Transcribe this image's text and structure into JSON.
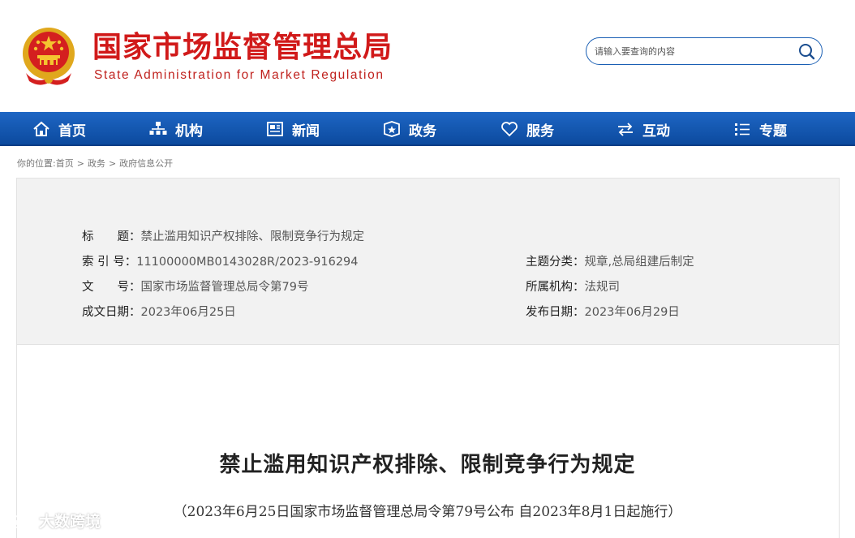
{
  "header": {
    "name_cn": "国家市场监督管理总局",
    "name_en": "State Administration for Market Regulation",
    "emblem_icon": "national-emblem-icon",
    "brand_color": "#d11a1a"
  },
  "search": {
    "placeholder": "请输入要查询的内容",
    "icon": "search-icon",
    "border_color": "#1a5fb4"
  },
  "nav": {
    "bar_color": "#1358b3",
    "items": [
      {
        "label": "首页",
        "icon": "home-icon"
      },
      {
        "label": "机构",
        "icon": "org-chart-icon"
      },
      {
        "label": "新闻",
        "icon": "news-icon"
      },
      {
        "label": "政务",
        "icon": "government-affairs-icon"
      },
      {
        "label": "服务",
        "icon": "heart-icon"
      },
      {
        "label": "互动",
        "icon": "exchange-icon"
      },
      {
        "label": "专题",
        "icon": "list-icon"
      }
    ]
  },
  "breadcrumb": {
    "prefix": "你的位置:",
    "items": [
      "首页",
      "政务",
      "政府信息公开"
    ],
    "separator": ">"
  },
  "info": {
    "title_label": "标　　题：",
    "title_value": "禁止滥用知识产权排除、限制竞争行为规定",
    "index_label": "索 引 号：",
    "index_value": "11100000MB0143028R/2023-916294",
    "docno_label": "文　　号：",
    "docno_value": "国家市场监督管理总局令第79号",
    "written_label": "成文日期：",
    "written_value": "2023年06月25日",
    "category_label": "主题分类：",
    "category_value": "规章,总局组建后制定",
    "agency_label": "所属机构：",
    "agency_value": "法规司",
    "published_label": "发布日期：",
    "published_value": "2023年06月29日"
  },
  "article": {
    "title": "禁止滥用知识产权排除、限制竞争行为规定",
    "subtitle": "（2023年6月25日国家市场监督管理总局令第79号公布  自2023年8月1日起施行）"
  },
  "watermark": {
    "text": "大数跨境",
    "icon": "watermark-logo-icon"
  }
}
